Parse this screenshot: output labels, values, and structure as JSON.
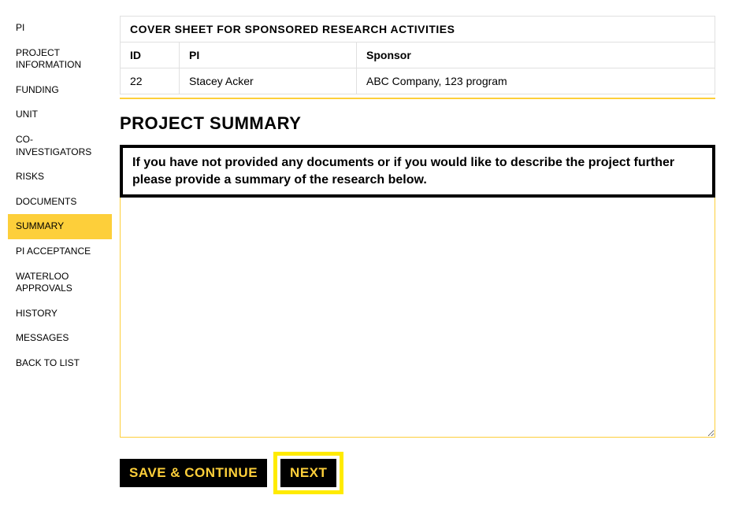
{
  "sidebar": {
    "items": [
      {
        "label": "PI"
      },
      {
        "label": "PROJECT INFORMATION"
      },
      {
        "label": "FUNDING"
      },
      {
        "label": "UNIT"
      },
      {
        "label": "CO-INVESTIGATORS"
      },
      {
        "label": "RISKS"
      },
      {
        "label": "DOCUMENTS"
      },
      {
        "label": "SUMMARY"
      },
      {
        "label": "PI ACCEPTANCE"
      },
      {
        "label": "WATERLOO APPROVALS"
      },
      {
        "label": "HISTORY"
      },
      {
        "label": "MESSAGES"
      },
      {
        "label": "BACK TO LIST"
      }
    ],
    "active_index": 7
  },
  "cover": {
    "title": "COVER SHEET FOR SPONSORED RESEARCH ACTIVITIES",
    "headers": {
      "id": "ID",
      "pi": "PI",
      "sponsor": "Sponsor"
    },
    "row": {
      "id": "22",
      "pi": "Stacey Acker",
      "sponsor": "ABC Company, 123 program"
    }
  },
  "section": {
    "heading": "PROJECT SUMMARY",
    "instruction": "If you have not provided any documents or if you would like to describe the project further please provide a summary of the research below."
  },
  "form": {
    "summary_value": ""
  },
  "buttons": {
    "save_continue": "SAVE & CONTINUE",
    "next": "NEXT"
  }
}
